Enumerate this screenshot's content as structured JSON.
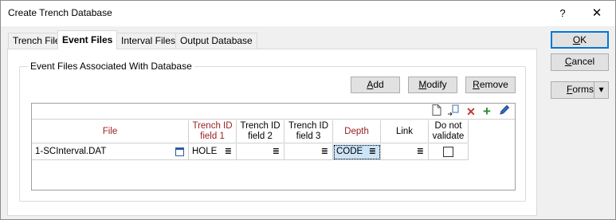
{
  "window": {
    "title": "Create Trench Database",
    "help_label": "?",
    "close_label": "✕"
  },
  "tabs": [
    {
      "label": "Trench File",
      "active": false
    },
    {
      "label": "Event Files",
      "active": true
    },
    {
      "label": "Interval Files",
      "active": false
    },
    {
      "label": "Output Database",
      "active": false
    }
  ],
  "group": {
    "legend": "Event Files Associated With Database"
  },
  "buttons": {
    "add": {
      "pre": "",
      "u": "A",
      "post": "dd"
    },
    "modify": {
      "pre": "",
      "u": "M",
      "post": "odify"
    },
    "remove": {
      "pre": "",
      "u": "R",
      "post": "emove"
    }
  },
  "toolbar_icons": [
    "new-file-icon",
    "export-icon",
    "delete-icon",
    "add-icon",
    "edit-pencil-icon"
  ],
  "grid": {
    "columns": [
      {
        "label": "File",
        "required": true
      },
      {
        "label": "Trench ID field 1",
        "required": true
      },
      {
        "label": "Trench ID field 2",
        "required": false
      },
      {
        "label": "Trench ID field 3",
        "required": false
      },
      {
        "label": "Depth",
        "required": true
      },
      {
        "label": "Link",
        "required": false
      },
      {
        "label": "Do not validate",
        "required": false
      }
    ],
    "rows": [
      {
        "file": "1-SCInterval.DAT",
        "trench_id_1": "HOLE",
        "trench_id_2": "",
        "trench_id_3": "",
        "depth": "CODE",
        "link": "",
        "do_not_validate": false
      }
    ],
    "list_glyph": "≣"
  },
  "side_buttons": {
    "ok": {
      "pre": "",
      "u": "O",
      "post": "K"
    },
    "cancel": {
      "pre": "",
      "u": "C",
      "post": "ancel"
    },
    "forms": {
      "pre": "",
      "u": "F",
      "post": "orms"
    },
    "forms_arrow": "▾"
  }
}
